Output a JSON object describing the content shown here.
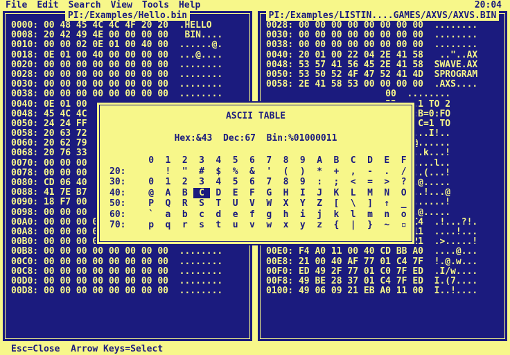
{
  "menu": [
    "File",
    "Edit",
    "Search",
    "View",
    "Tools",
    "Help"
  ],
  "clock": "20:04",
  "left_pane": {
    "title": "PI:/Examples/Hello.bin",
    "rows": [
      "0000: 00 48 45 4C 4C 4F 20 20  .HELLO  ",
      "0008: 20 42 49 4E 00 00 00 00   BIN....",
      "0010: 00 00 02 0E 01 00 40 00  ......@.",
      "0018: 0E 01 00 40 00 00 00 00  ...@....",
      "0020: 00 00 00 00 00 00 00 00  ........",
      "0028: 00 00 00 00 00 00 00 00  ........",
      "0030: 00 00 00 00 00 00 00 00  ........",
      "0038: 00 00 00 00 00 00 00 00  ........",
      "0040: 0E 01 00",
      "0048: 45 4C 4C",
      "0050: 24 24 FF",
      "0058: 20 63 72",
      "0060: 20 62 79",
      "0068: 20 76 33",
      "0070: 00 00 00",
      "0078: 00 00 00",
      "0080: CD 06 40",
      "0088: 41 7E B7",
      "0090: 18 F7 00",
      "0098: 00 00 00",
      "00A0: 00 00 00 00 00 00 00 00  ........",
      "00A8: 00 00 00 00 00 00 00 00  ........",
      "00B0: 00 00 00 00 00 00 00 00  ........",
      "00B8: 00 00 00 00 00 00 00 00  ........",
      "00C0: 00 00 00 00 00 00 00 00  ........",
      "00C8: 00 00 00 00 00 00 00 00  ........",
      "00D0: 00 00 00 00 00 00 00 00  ........",
      "00D8: 00 00 00 00 00 00 00 00  ........"
    ]
  },
  "right_pane": {
    "title": "PI:/Examples/LISTIN....GAMES/AXVS/AXVS.BIN",
    "rows": [
      "0028: 00 00 00 00 00 00 00 00  ........",
      "0030: 00 00 00 00 00 00 00 00  ........",
      "0038: 00 00 00 00 00 00 00 00  ........",
      "0040: 20 01 00 22 04 2E 41 58   ..\"..AX",
      "0048: 53 57 41 56 45 2E 41 58  SWAVE.AX",
      "0050: 53 50 52 4F 47 52 41 4D  SPROGRAM",
      "0058: 2E 41 58 53 00 00 00 00  .AXS....",
      "                      00  ........",
      "                      32  ..1 TO 2",
      "                      4F  0:B=0:FO",
      "                      4F  R C=1 TO",
      "                      B0  ,...I!..",
      "                      BC  .@......",
      "                      21  >..k...!",
      "                      21  .....l..",
      "                      21  ...(...!",
      "                      F5  ..@.....",
      "                      40  v..!...@",
      "                      0A  .......!",
      "                      21  ..@.....",
      "00C8: 0A 21 D9 A0 11 3F 21 C4  .!...?!.",
      "00D0: BB A0 06 08 21 E3 A0 11  ....!...",
      "00D8: 00 3E CD BB A0 06 0B 21  .>.....!",
      "00E0: F4 A0 11 00 40 CD BB A0  ....@...",
      "00E8: 21 00 40 AF 77 01 C4 7F  !.@.w...",
      "00F0: ED 49 2F 77 01 C0 7F ED  .I/w....",
      "00F8: 49 BE 28 37 01 C4 7F ED  I.(7....",
      "0100: 49 06 09 21 EB A0 11 00  I..!...."
    ]
  },
  "dialog": {
    "title": "ASCII TABLE",
    "hex": "Hex:&43",
    "dec": "Dec:67",
    "bin": "Bin:%01000011",
    "columns": [
      "0",
      "1",
      "2",
      "3",
      "4",
      "5",
      "6",
      "7",
      "8",
      "9",
      "A",
      "B",
      "C",
      "D",
      "E",
      "F"
    ],
    "rows": [
      {
        "label": "20:",
        "chars": [
          " ",
          "!",
          "\"",
          "#",
          "$",
          "%",
          "&",
          "'",
          "(",
          ")",
          "*",
          "+",
          ",",
          "-",
          ".",
          "/"
        ]
      },
      {
        "label": "30:",
        "chars": [
          "0",
          "1",
          "2",
          "3",
          "4",
          "5",
          "6",
          "7",
          "8",
          "9",
          ":",
          ";",
          "<",
          "=",
          ">",
          "?"
        ]
      },
      {
        "label": "40:",
        "chars": [
          "@",
          "A",
          "B",
          "C",
          "D",
          "E",
          "F",
          "G",
          "H",
          "I",
          "J",
          "K",
          "L",
          "M",
          "N",
          "O"
        ]
      },
      {
        "label": "50:",
        "chars": [
          "P",
          "Q",
          "R",
          "S",
          "T",
          "U",
          "V",
          "W",
          "X",
          "Y",
          "Z",
          "[",
          "\\",
          "]",
          "↑",
          "_"
        ]
      },
      {
        "label": "60:",
        "chars": [
          "`",
          "a",
          "b",
          "c",
          "d",
          "e",
          "f",
          "g",
          "h",
          "i",
          "j",
          "k",
          "l",
          "m",
          "n",
          "o"
        ]
      },
      {
        "label": "70:",
        "chars": [
          "p",
          "q",
          "r",
          "s",
          "t",
          "u",
          "v",
          "w",
          "x",
          "y",
          "z",
          "{",
          "|",
          "}",
          "~",
          "▫"
        ]
      }
    ],
    "selected": {
      "row": 2,
      "col": 3
    }
  },
  "status": "Esc=Close  Arrow Keys=Select"
}
